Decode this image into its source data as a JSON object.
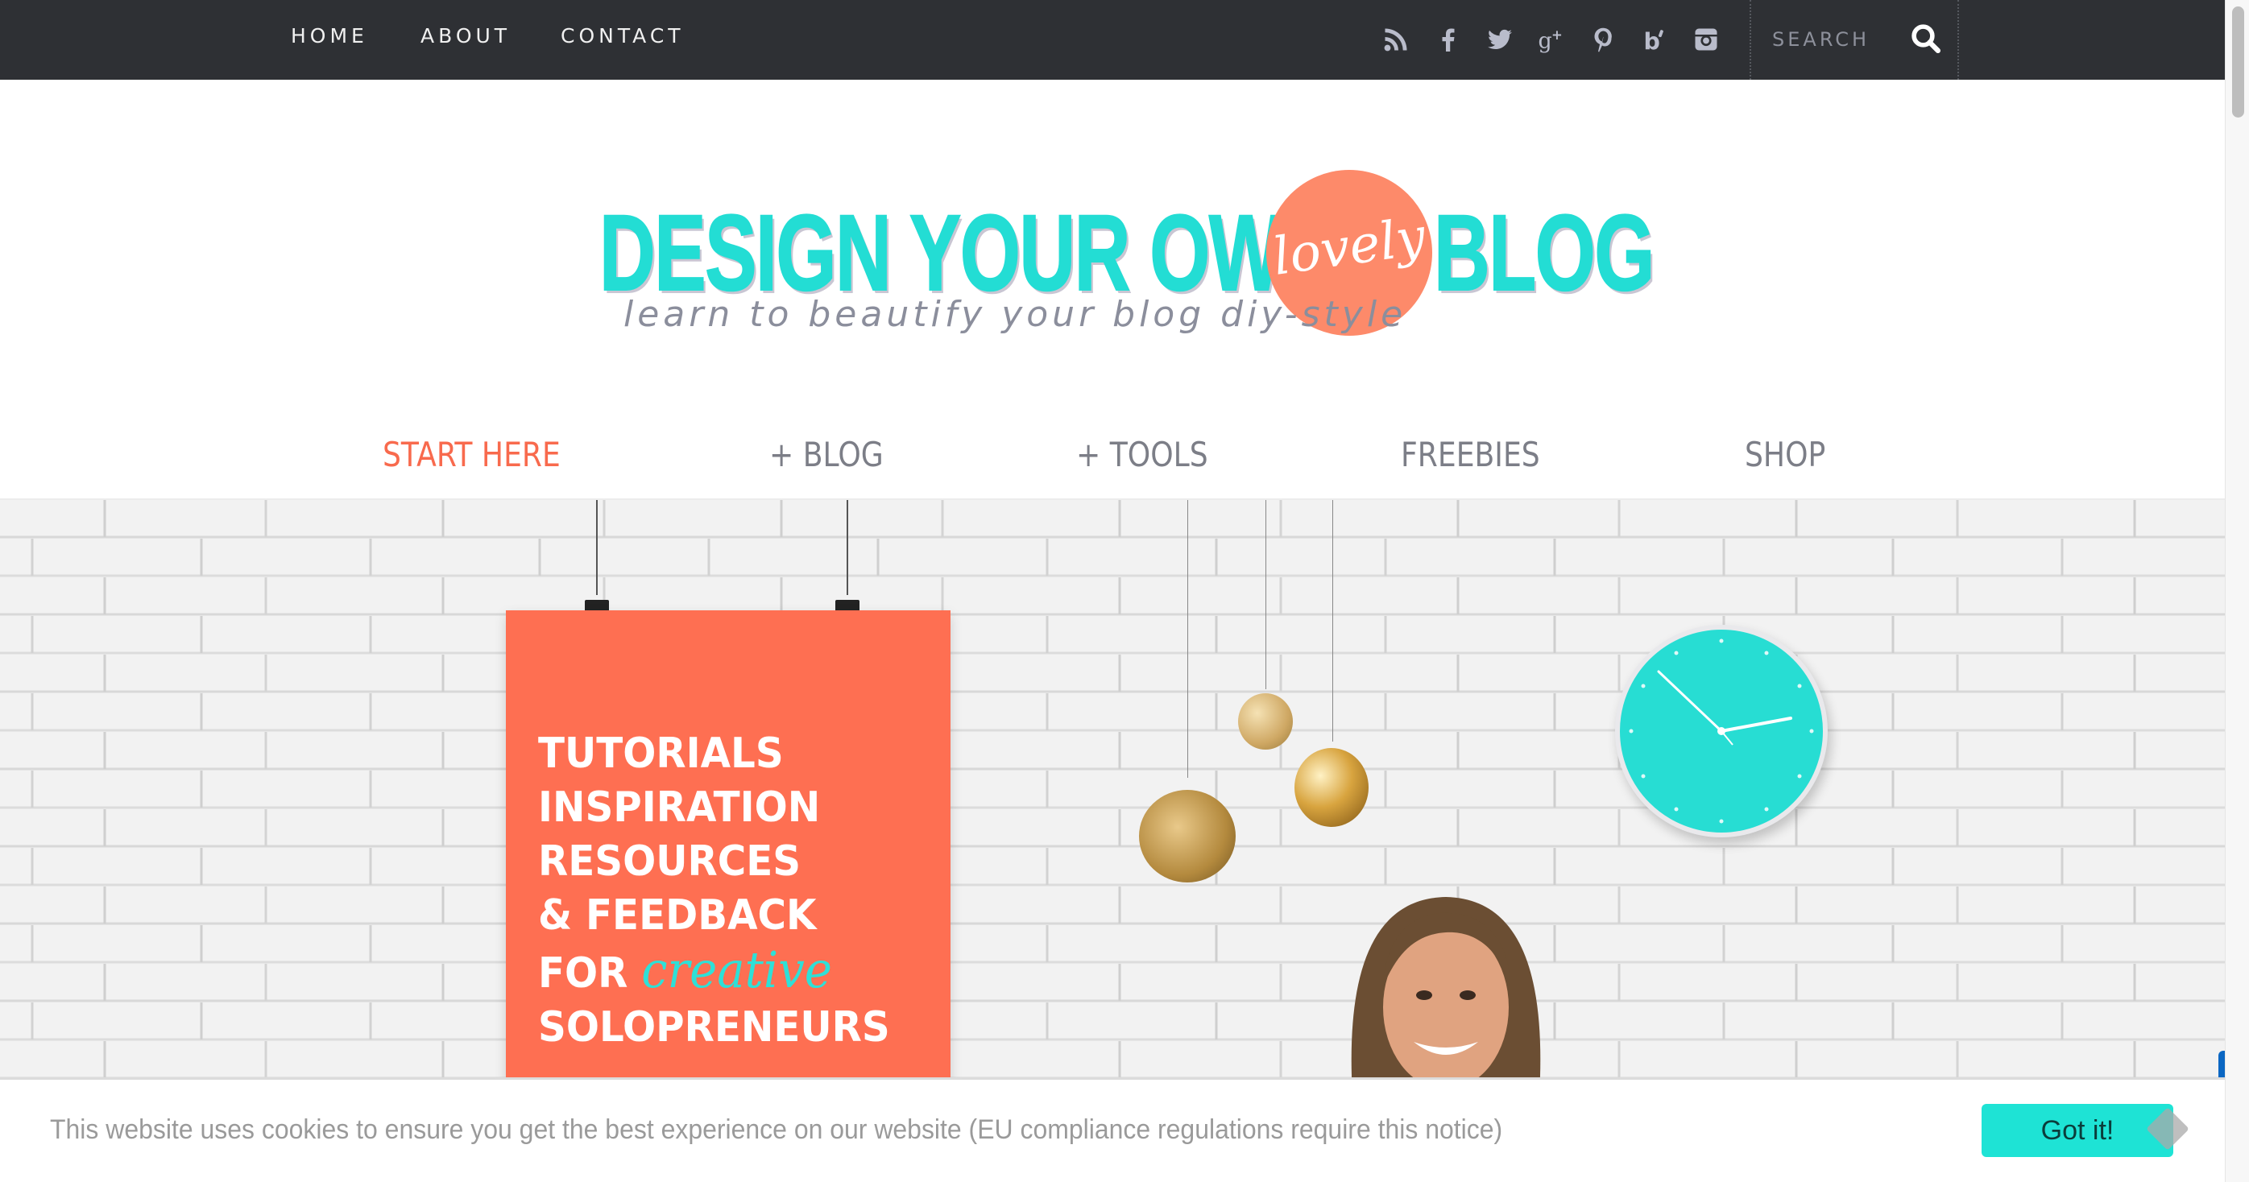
{
  "top_nav": {
    "links": [
      "HOME",
      "ABOUT",
      "CONTACT"
    ]
  },
  "social_icons": [
    "rss-icon",
    "facebook-icon",
    "twitter-icon",
    "google-plus-icon",
    "pinterest-icon",
    "bloglovin-icon",
    "instagram-icon"
  ],
  "search": {
    "placeholder": "SEARCH",
    "icon": "search-icon"
  },
  "logo": {
    "title_left": "DESIGN YOUR OWN",
    "title_script": "lovely",
    "title_right": "BLOG",
    "tagline": "learn to beautify your blog diy-style"
  },
  "main_nav": {
    "items": [
      {
        "label": "START HERE",
        "active": true
      },
      {
        "label": "+ BLOG",
        "active": false
      },
      {
        "label": "+ TOOLS",
        "active": false
      },
      {
        "label": "FREEBIES",
        "active": false
      },
      {
        "label": "SHOP",
        "active": false
      }
    ]
  },
  "hero": {
    "poster_lines": [
      "TUTORIALS",
      "INSPIRATION",
      "RESOURCES",
      "& FEEDBACK"
    ],
    "poster_for": "FOR",
    "poster_script": "creative",
    "poster_last": "SOLOPRENEURS"
  },
  "cookie_notice": {
    "text": "This website uses cookies to ensure you get the best experience on our website (EU compliance regulations require this notice)",
    "button_label": "Got it!"
  },
  "colors": {
    "topbar": "#2e3034",
    "accent_teal": "#23ddd4",
    "accent_coral": "#fe6f52",
    "nav_active": "#f86a4d",
    "nav_text": "#7c7e87",
    "cookie_button": "#1ee3d5"
  }
}
